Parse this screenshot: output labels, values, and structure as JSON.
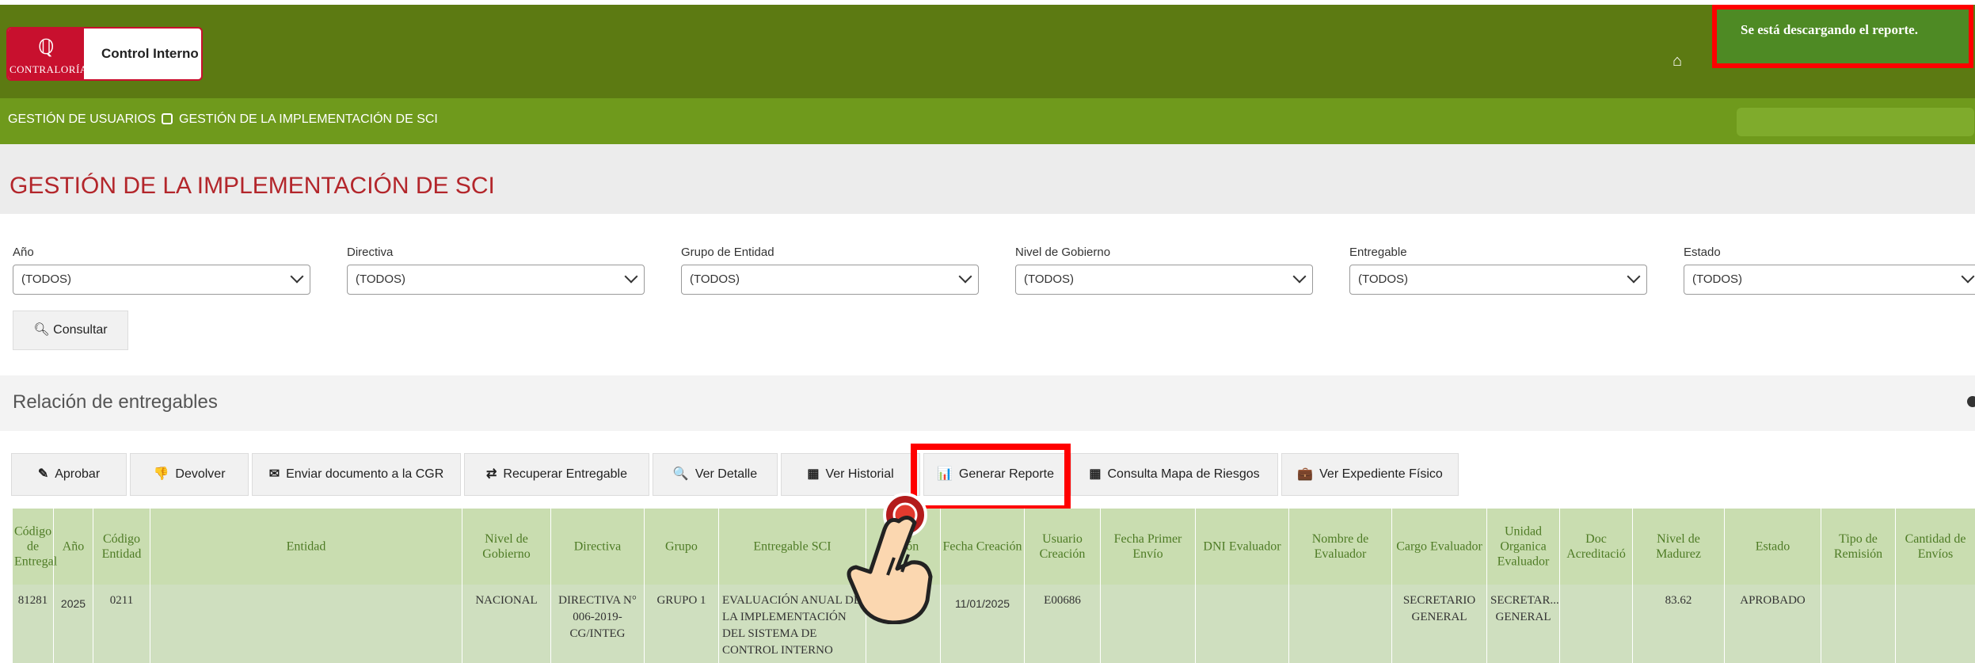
{
  "header": {
    "logo_name": "CONTRALORÍA",
    "app_title": "Control Interno",
    "home_icon": "home-icon",
    "user_text": "..."
  },
  "toast": {
    "message": "Se está descargando el reporte."
  },
  "nav": {
    "items": [
      {
        "label": "GESTIÓN DE USUARIOS",
        "icon": "users-icon"
      },
      {
        "label": "GESTIÓN DE LA IMPLEMENTACIÓN DE SCI",
        "icon": "document-icon"
      }
    ]
  },
  "page": {
    "title": "GESTIÓN DE LA IMPLEMENTACIÓN DE SCI"
  },
  "filters": [
    {
      "label": "Año",
      "value": "(TODOS)"
    },
    {
      "label": "Directiva",
      "value": "(TODOS)"
    },
    {
      "label": "Grupo de Entidad",
      "value": "(TODOS)"
    },
    {
      "label": "Nivel de Gobierno",
      "value": "(TODOS)"
    },
    {
      "label": "Entregable",
      "value": "(TODOS)"
    },
    {
      "label": "Estado",
      "value": "(TODOS)"
    }
  ],
  "consultar_label": "Consultar",
  "section": {
    "title": "Relación de entregables"
  },
  "toolbar": {
    "buttons": [
      {
        "label": "Aprobar",
        "icon": "✎"
      },
      {
        "label": "Devolver",
        "icon": "👎"
      },
      {
        "label": "Enviar documento a la CGR",
        "icon": "✉"
      },
      {
        "label": "Recuperar Entregable",
        "icon": "⇄"
      },
      {
        "label": "Ver Detalle",
        "icon": "🔍"
      },
      {
        "label": "Ver Historial",
        "icon": "▦"
      },
      {
        "label": "Generar Reporte",
        "icon": "📊"
      },
      {
        "label": "Consulta Mapa de Riesgos",
        "icon": "▦"
      },
      {
        "label": "Ver Expediente Físico",
        "icon": "💼"
      }
    ]
  },
  "table": {
    "headers": [
      "Código de Entregal",
      "Año",
      "Código Entidad",
      "Entidad",
      "Nivel de Gobierno",
      "Directiva",
      "Grupo",
      "Entregable SCI",
      "de ión",
      "Fecha Creación",
      "Usuario Creación",
      "Fecha Primer Envío",
      "DNI Evaluador",
      "Nombre de Evaluador",
      "Cargo Evaluador",
      "Unidad Organica Evaluador",
      "Doc Acreditació",
      "Nivel de Madurez",
      "Estado",
      "Tipo de Remisión",
      "Cantidad de Envíos"
    ],
    "rows": [
      {
        "cells": [
          "81281",
          "2025",
          "0211",
          "",
          "NACIONAL",
          "DIRECTIVA N° 006-2019-CG/INTEG",
          "GRUPO 1",
          "EVALUACIÓN ANUAL DE LA IMPLEMENTACIÓN DEL SISTEMA DE CONTROL INTERNO",
          "AP",
          "11/01/2025",
          "E00686",
          "",
          "",
          "",
          "SECRETARIO GENERAL",
          "SECRETAR... GENERAL",
          "",
          "83.62",
          "APROBADO",
          "",
          ""
        ]
      }
    ]
  },
  "colors": {
    "topbar": "#5c7a12",
    "navbar": "#6f9a1c",
    "title_red": "#b3262b",
    "highlight": "#ff0000",
    "table_header": "#c9ddb0",
    "table_row": "#cfdfbf"
  }
}
